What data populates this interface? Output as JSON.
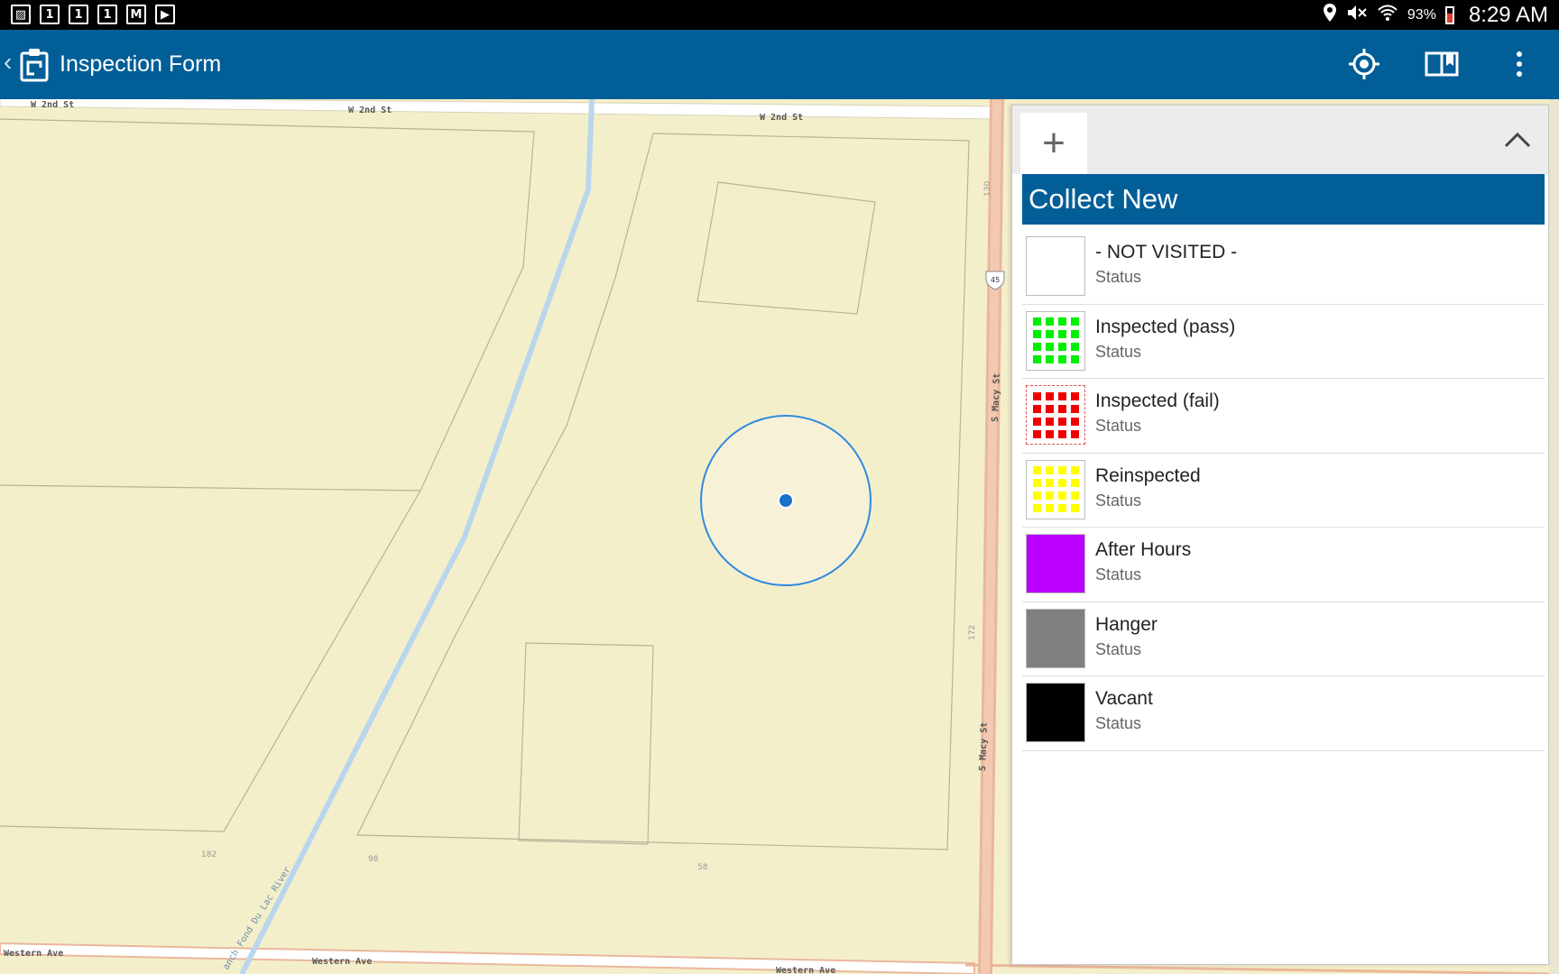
{
  "status_bar": {
    "left_icons": [
      {
        "name": "gallery-icon",
        "glyph": "▨"
      },
      {
        "name": "calendar-1-icon",
        "glyph": "1"
      },
      {
        "name": "calendar-1-icon",
        "glyph": "1"
      },
      {
        "name": "calendar-1-icon",
        "glyph": "1"
      },
      {
        "name": "gmail-icon",
        "glyph": "M"
      },
      {
        "name": "store-bag-icon",
        "glyph": "▶"
      }
    ],
    "battery": "93%",
    "time": "8:29 AM"
  },
  "appbar": {
    "title": "Inspection Form",
    "actions": [
      "locate-icon",
      "book-icon",
      "overflow-menu-icon"
    ]
  },
  "map": {
    "street_labels": {
      "w2nd_a": "W 2nd St",
      "w2nd_b": "W 2nd St",
      "w2nd_c": "W 2nd St",
      "macy_a": "S Macy St",
      "macy_b": "S Macy St",
      "western_a": "Western Ave",
      "western_b": "Western Ave",
      "western_c": "Western Ave",
      "river": "anch Fond Du Lac River",
      "route_shield": "45",
      "addr_130": "130",
      "addr_172": "172",
      "addr_182": "182",
      "addr_98": "98",
      "addr_58": "58"
    },
    "colors": {
      "land": "#f4efcb",
      "road_major": "#eab79b",
      "water": "#b9d7ec",
      "accuracy_circle": "#2f8ae0",
      "location_dot": "#1a73c9"
    }
  },
  "panel": {
    "add_label": "+",
    "header": "Collect New",
    "items": [
      {
        "title": "- NOT VISITED -",
        "subtitle": "Status",
        "fill": "#ffffff",
        "pattern": "solid",
        "border": "#bbbbbb"
      },
      {
        "title": "Inspected (pass)",
        "subtitle": "Status",
        "fill": "#00ee00",
        "pattern": "dots",
        "border": "#bbbbbb"
      },
      {
        "title": "Inspected (fail)",
        "subtitle": "Status",
        "fill": "#ee0000",
        "pattern": "dots",
        "border": "#e05050"
      },
      {
        "title": "Reinspected",
        "subtitle": "Status",
        "fill": "#ffff00",
        "pattern": "dots",
        "border": "#bbbbbb"
      },
      {
        "title": "After Hours",
        "subtitle": "Status",
        "fill": "#bb00ff",
        "pattern": "solid",
        "border": "#bbbbbb"
      },
      {
        "title": "Hanger",
        "subtitle": "Status",
        "fill": "#808080",
        "pattern": "solid",
        "border": "#bbbbbb"
      },
      {
        "title": "Vacant",
        "subtitle": "Status",
        "fill": "#000000",
        "pattern": "solid",
        "border": "#bbbbbb"
      }
    ]
  }
}
